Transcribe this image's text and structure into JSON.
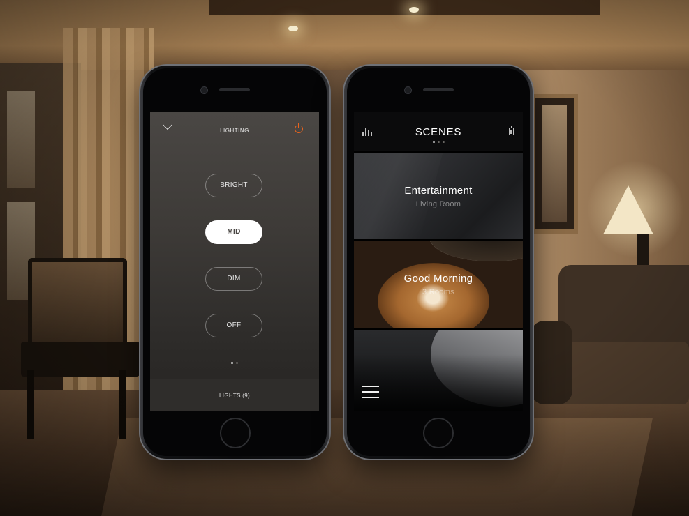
{
  "lighting_screen": {
    "title": "LIGHTING",
    "presets": [
      {
        "label": "BRIGHT",
        "selected": false
      },
      {
        "label": "MID",
        "selected": true
      },
      {
        "label": "DIM",
        "selected": false
      },
      {
        "label": "OFF",
        "selected": false
      }
    ],
    "page_indicator": {
      "pages": 2,
      "current": 1
    },
    "footer_label": "LIGHTS (9)",
    "accent_color": "#e8631d",
    "icons": [
      "chevron-down-icon",
      "power-icon"
    ]
  },
  "scenes_screen": {
    "title": "SCENES",
    "page_indicator": {
      "pages": 3,
      "current": 1
    },
    "scenes": [
      {
        "name": "Entertainment",
        "subtitle": "Living Room"
      },
      {
        "name": "Good Morning",
        "subtitle": "3 Rooms"
      },
      {
        "name": "",
        "subtitle": ""
      }
    ],
    "icons": [
      "equalizer-icon",
      "battery-icon",
      "menu-icon"
    ]
  }
}
